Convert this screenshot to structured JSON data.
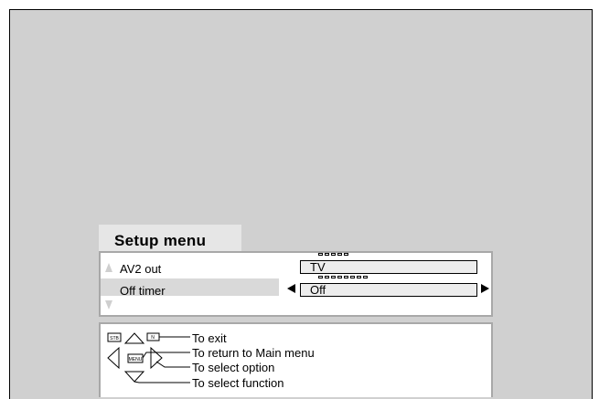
{
  "menu": {
    "title": "Setup menu",
    "items": [
      {
        "label": "AV2 out",
        "value": "TV"
      },
      {
        "label": "Off timer",
        "value": "Off"
      }
    ]
  },
  "help": {
    "buttons": {
      "stb": "STB",
      "n": "N",
      "menu": "MENU"
    },
    "lines": [
      "To exit",
      "To return to Main menu",
      "To select option",
      "To select function"
    ]
  },
  "colors": {
    "screen_bg": "#d0d0d0",
    "panel_bg": "#ffffff",
    "highlight": "#d9d9d9",
    "border": "#a8a8a8"
  }
}
